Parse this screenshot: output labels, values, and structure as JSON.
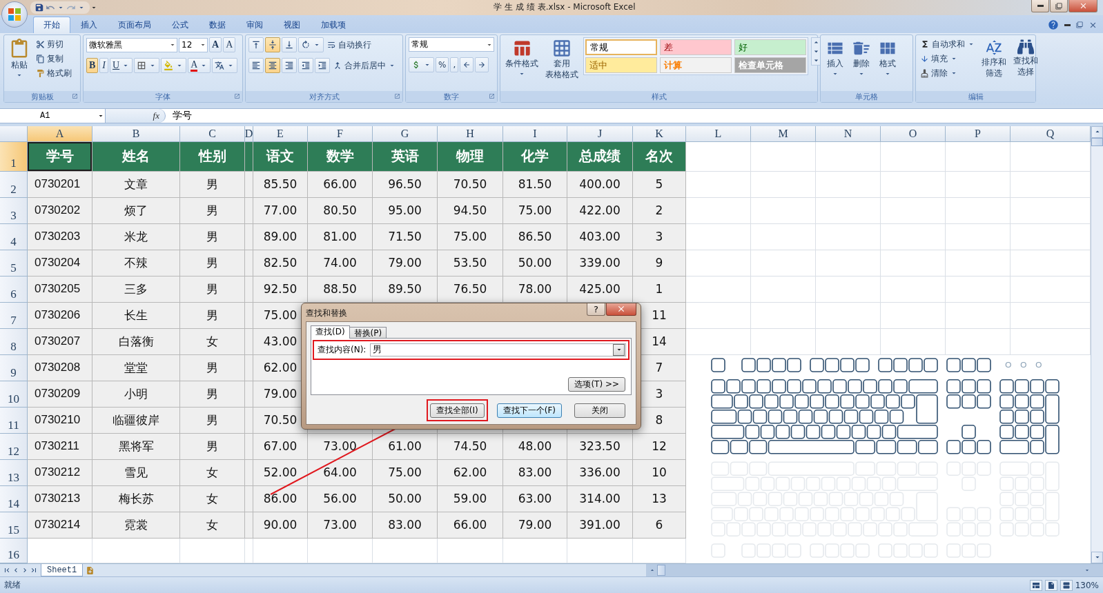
{
  "window": {
    "title": "学 生 成 绩 表.xlsx - Microsoft Excel"
  },
  "tabs": [
    {
      "label": "开始",
      "selected": true
    },
    {
      "label": "插入",
      "selected": false
    },
    {
      "label": "页面布局",
      "selected": false
    },
    {
      "label": "公式",
      "selected": false
    },
    {
      "label": "数据",
      "selected": false
    },
    {
      "label": "审阅",
      "selected": false
    },
    {
      "label": "视图",
      "selected": false
    },
    {
      "label": "加载项",
      "selected": false
    }
  ],
  "ribbon": {
    "clipboard": {
      "label": "剪贴板",
      "paste": "粘贴",
      "cut": "剪切",
      "copy": "复制",
      "format_painter": "格式刷"
    },
    "font": {
      "label": "字体",
      "font_name": "微软雅黑",
      "font_size": "12",
      "grow": "A",
      "shrink": "A",
      "bold": "B",
      "italic": "I",
      "underline": "U",
      "font_color": "A"
    },
    "alignment": {
      "label": "对齐方式",
      "vertical": [
        {
          "selected": false
        },
        {
          "selected": true
        },
        {
          "selected": false
        }
      ],
      "horizontal": [
        {
          "selected": false
        },
        {
          "selected": true
        },
        {
          "selected": false
        }
      ],
      "wrap_text": "自动换行",
      "merge_center": "合并后居中"
    },
    "number": {
      "label": "数字",
      "format": "常规",
      "percent": "%",
      "comma": ","
    },
    "styles": {
      "label": "样式",
      "conditional": [
        "条件格式"
      ],
      "table_format": [
        "套用",
        "表格格式"
      ],
      "cell_styles": [
        {
          "label": "常规",
          "kind": "normal",
          "color": "#ffffff",
          "selected": true
        },
        {
          "label": "差",
          "kind": "bad",
          "color": "#ffc7ce",
          "selected": false
        },
        {
          "label": "好",
          "kind": "good",
          "color": "#c6efce",
          "selected": false
        },
        {
          "label": "适中",
          "kind": "neutral",
          "color": "#ffeb9c",
          "selected": false
        },
        {
          "label": "计算",
          "kind": "calculation",
          "color": "#f2f2f2",
          "selected": false
        },
        {
          "label": "检查单元格",
          "kind": "check",
          "color": "#a5a5a5",
          "selected": false
        }
      ]
    },
    "cells": {
      "label": "单元格",
      "buttons": [
        "插入",
        "删除",
        "格式"
      ]
    },
    "editing": {
      "label": "编辑",
      "autosum": "自动求和",
      "fill": "填充",
      "clear": "清除",
      "sort": [
        "排序和",
        "筛选"
      ],
      "find": [
        "查找和",
        "选择"
      ]
    }
  },
  "formula_bar": {
    "name_box": "A1",
    "function_label": "fx",
    "content": "学号"
  },
  "sheet": {
    "columns": [
      {
        "label": "A",
        "selected": true
      },
      {
        "label": "B",
        "selected": false
      },
      {
        "label": "C",
        "selected": false
      },
      {
        "label": "D",
        "selected": false
      },
      {
        "label": "E",
        "selected": false
      },
      {
        "label": "F",
        "selected": false
      },
      {
        "label": "G",
        "selected": false
      },
      {
        "label": "H",
        "selected": false
      },
      {
        "label": "I",
        "selected": false
      },
      {
        "label": "J",
        "selected": false
      },
      {
        "label": "K",
        "selected": false
      },
      {
        "label": "L",
        "selected": false
      },
      {
        "label": "M",
        "selected": false
      },
      {
        "label": "N",
        "selected": false
      },
      {
        "label": "O",
        "selected": false
      },
      {
        "label": "P",
        "selected": false
      },
      {
        "label": "Q",
        "selected": false
      }
    ],
    "rows": [
      {
        "number": "1",
        "selected": true,
        "kind": "header",
        "cells": [
          "学号",
          "姓名",
          "性别",
          "语文",
          "数学",
          "英语",
          "物理",
          "化学",
          "总成绩",
          "名次"
        ]
      },
      {
        "number": "2",
        "selected": false,
        "kind": "data",
        "cells": [
          "0730201",
          "文章",
          "男",
          "85.50",
          "66.00",
          "96.50",
          "70.50",
          "81.50",
          "400.00",
          "5"
        ]
      },
      {
        "number": "3",
        "selected": false,
        "kind": "data",
        "cells": [
          "0730202",
          "烦了",
          "男",
          "77.00",
          "80.50",
          "95.00",
          "94.50",
          "75.00",
          "422.00",
          "2"
        ]
      },
      {
        "number": "4",
        "selected": false,
        "kind": "data",
        "cells": [
          "0730203",
          "米龙",
          "男",
          "89.00",
          "81.00",
          "71.50",
          "75.00",
          "86.50",
          "403.00",
          "3"
        ]
      },
      {
        "number": "5",
        "selected": false,
        "kind": "data",
        "cells": [
          "0730204",
          "不辣",
          "男",
          "82.50",
          "74.00",
          "79.00",
          "53.50",
          "50.00",
          "339.00",
          "9"
        ]
      },
      {
        "number": "6",
        "selected": false,
        "kind": "data",
        "cells": [
          "0730205",
          "三多",
          "男",
          "92.50",
          "88.50",
          "89.50",
          "76.50",
          "78.00",
          "425.00",
          "1"
        ]
      },
      {
        "number": "7",
        "selected": false,
        "kind": "covered",
        "cells": [
          "0730206",
          "长生",
          "男",
          "75.00",
          "11"
        ]
      },
      {
        "number": "8",
        "selected": false,
        "kind": "covered",
        "cells": [
          "0730207",
          "白落衡",
          "女",
          "43.00",
          "14"
        ]
      },
      {
        "number": "9",
        "selected": false,
        "kind": "covered",
        "cells": [
          "0730208",
          "堂堂",
          "男",
          "62.00",
          "7"
        ]
      },
      {
        "number": "10",
        "selected": false,
        "kind": "covered",
        "cells": [
          "0730209",
          "小明",
          "男",
          "79.00",
          "3"
        ]
      },
      {
        "number": "11",
        "selected": false,
        "kind": "covered",
        "cells": [
          "0730210",
          "临疆彼岸",
          "男",
          "70.50",
          "8"
        ]
      },
      {
        "number": "12",
        "selected": false,
        "kind": "data",
        "cells": [
          "0730211",
          "黑将军",
          "男",
          "67.00",
          "73.00",
          "61.00",
          "74.50",
          "48.00",
          "323.50",
          "12"
        ]
      },
      {
        "number": "13",
        "selected": false,
        "kind": "data",
        "cells": [
          "0730212",
          "雪见",
          "女",
          "52.00",
          "64.00",
          "75.00",
          "62.00",
          "83.00",
          "336.00",
          "10"
        ]
      },
      {
        "number": "14",
        "selected": false,
        "kind": "data",
        "cells": [
          "0730213",
          "梅长苏",
          "女",
          "86.00",
          "56.00",
          "50.00",
          "59.00",
          "63.00",
          "314.00",
          "13"
        ]
      },
      {
        "number": "15",
        "selected": false,
        "kind": "data",
        "cells": [
          "0730214",
          "霓裳",
          "女",
          "90.00",
          "73.00",
          "83.00",
          "66.00",
          "79.00",
          "391.00",
          "6"
        ]
      },
      {
        "number": "16",
        "selected": false,
        "kind": "empty"
      }
    ]
  },
  "dialog": {
    "title": "查找和替换",
    "help": "?",
    "tabs": [
      {
        "label": "查找(D)",
        "selected": true
      },
      {
        "label": "替换(P)",
        "selected": false
      }
    ],
    "find_label": "查找内容(N):",
    "find_value": "男",
    "find_highlighted": true,
    "options": "选项(T) >>",
    "buttons": [
      {
        "label": "查找全部(I)",
        "highlighted": true,
        "default": false
      },
      {
        "label": "查找下一个(F)",
        "highlighted": false,
        "default": true
      },
      {
        "label": "关闭",
        "highlighted": false,
        "default": false
      }
    ]
  },
  "sheet_tabs": [
    {
      "label": "Sheet1",
      "selected": true
    }
  ],
  "status_bar": {
    "status": "就绪",
    "zoom": "130%"
  }
}
